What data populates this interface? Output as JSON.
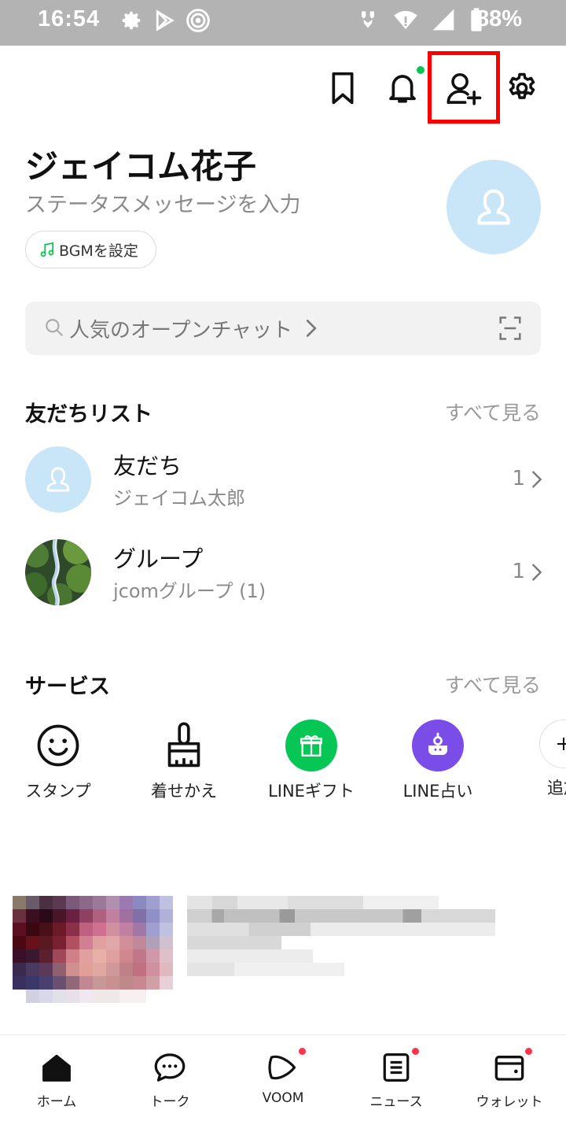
{
  "status_bar": {
    "time": "16:54",
    "battery": "88%"
  },
  "header": {
    "icons": [
      "bookmark-icon",
      "bell-icon",
      "add-friend-icon",
      "gear-icon"
    ],
    "notification_dot_color": "#06c755",
    "highlight_color": "#ff0000"
  },
  "profile": {
    "name": "ジェイコム花子",
    "status_message": "ステータスメッセージを入力",
    "bgm_label": "BGMを設定",
    "avatar_color": "#c8e6f7"
  },
  "search": {
    "placeholder": "人気のオープンチャット"
  },
  "friends_section": {
    "title": "友だちリスト",
    "see_all": "すべて見る",
    "items": [
      {
        "title": "友だち",
        "subtitle": "ジェイコム太郎",
        "count": "1"
      },
      {
        "title": "グループ",
        "subtitle": "jcomグループ (1)",
        "count": "1"
      }
    ]
  },
  "services_section": {
    "title": "サービス",
    "see_all": "すべて見る",
    "items": [
      {
        "label": "スタンプ",
        "icon": "smile-icon"
      },
      {
        "label": "着せかえ",
        "icon": "brush-icon"
      },
      {
        "label": "LINEギフト",
        "icon": "gift-icon",
        "color": "#06c755"
      },
      {
        "label": "LINE占い",
        "icon": "fortune-icon",
        "color": "#7a4de8"
      },
      {
        "label": "追加",
        "icon": "plus-icon"
      }
    ]
  },
  "bottom_nav": {
    "items": [
      {
        "label": "ホーム",
        "icon": "home-icon"
      },
      {
        "label": "トーク",
        "icon": "chat-icon"
      },
      {
        "label": "VOOM",
        "icon": "voom-icon"
      },
      {
        "label": "ニュース",
        "icon": "news-icon"
      },
      {
        "label": "ウォレット",
        "icon": "wallet-icon"
      }
    ],
    "badge_color": "#ff334b"
  }
}
